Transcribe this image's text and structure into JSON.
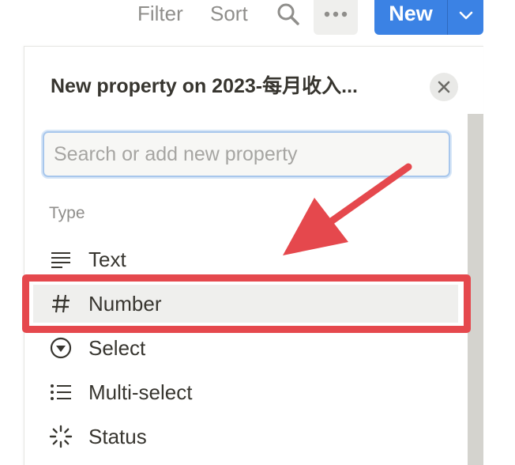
{
  "toolbar": {
    "filter_label": "Filter",
    "sort_label": "Sort",
    "search_icon": "search-icon",
    "more_icon": "more-horizontal-icon",
    "new_label": "New",
    "new_dropdown_icon": "chevron-down-icon",
    "accent_color": "#3b82e4"
  },
  "panel": {
    "title": "New property on 2023-每月收入...",
    "close_icon": "close-icon",
    "search": {
      "placeholder": "Search or add new property",
      "value": ""
    },
    "section_label": "Type",
    "types": [
      {
        "label": "Text",
        "icon": "text-lines-icon"
      },
      {
        "label": "Number",
        "icon": "hash-icon"
      },
      {
        "label": "Select",
        "icon": "select-circle-icon"
      },
      {
        "label": "Multi-select",
        "icon": "list-icon"
      },
      {
        "label": "Status",
        "icon": "status-loader-icon"
      }
    ]
  },
  "annotation": {
    "highlight_color": "#e5484d",
    "highlighted_item": "Number"
  }
}
